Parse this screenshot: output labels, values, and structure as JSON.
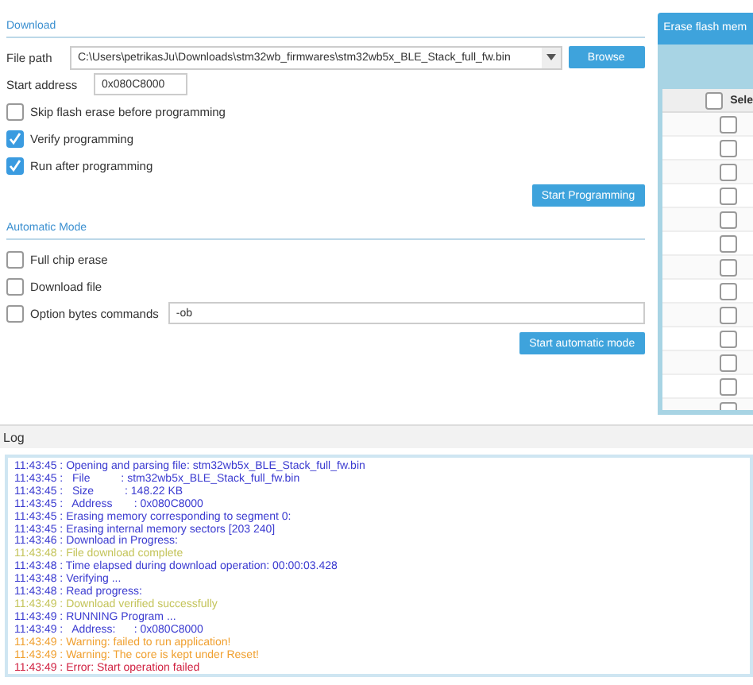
{
  "download": {
    "title": "Download",
    "file_path": {
      "label": "File path",
      "value": "C:\\Users\\petrikasJu\\Downloads\\stm32wb_firmwares\\stm32wb5x_BLE_Stack_full_fw.bin"
    },
    "browse_button": "Browse",
    "start_address": {
      "label": "Start address",
      "value": "0x080C8000"
    },
    "options": [
      {
        "label": "Skip flash erase before programming",
        "checked": false
      },
      {
        "label": "Verify programming",
        "checked": true
      },
      {
        "label": "Run after programming",
        "checked": true
      }
    ],
    "start_button": "Start Programming"
  },
  "automatic_mode": {
    "title": "Automatic Mode",
    "options": [
      {
        "label": "Full chip erase",
        "checked": false
      },
      {
        "label": "Download file",
        "checked": false
      },
      {
        "label": "Option bytes commands",
        "checked": false,
        "value": "-ob"
      }
    ],
    "start_button": "Start automatic mode"
  },
  "erase_panel": {
    "tab": "Erase flash mem",
    "table": {
      "select_all_checked": false,
      "header": "Sele",
      "rows": [
        {
          "checked": false
        },
        {
          "checked": false
        },
        {
          "checked": false
        },
        {
          "checked": false
        },
        {
          "checked": false
        },
        {
          "checked": false
        },
        {
          "checked": false
        },
        {
          "checked": false
        },
        {
          "checked": false
        },
        {
          "checked": false
        },
        {
          "checked": false
        },
        {
          "checked": false
        },
        {
          "checked": false
        }
      ]
    }
  },
  "log": {
    "title": "Log",
    "lines": [
      {
        "kind": "info",
        "text": "11:43:45 : Opening and parsing file: stm32wb5x_BLE_Stack_full_fw.bin"
      },
      {
        "kind": "info",
        "text": "11:43:45 :   File          : stm32wb5x_BLE_Stack_full_fw.bin"
      },
      {
        "kind": "info",
        "text": "11:43:45 :   Size          : 148.22 KB"
      },
      {
        "kind": "info",
        "text": "11:43:45 :   Address       : 0x080C8000"
      },
      {
        "kind": "info",
        "text": "11:43:45 : Erasing memory corresponding to segment 0:"
      },
      {
        "kind": "info",
        "text": "11:43:45 : Erasing internal memory sectors [203 240]"
      },
      {
        "kind": "info",
        "text": "11:43:46 : Download in Progress:"
      },
      {
        "kind": "success",
        "text": "11:43:48 : File download complete"
      },
      {
        "kind": "info",
        "text": "11:43:48 : Time elapsed during download operation: 00:00:03.428"
      },
      {
        "kind": "info",
        "text": "11:43:48 : Verifying ..."
      },
      {
        "kind": "info",
        "text": "11:43:48 : Read progress:"
      },
      {
        "kind": "success",
        "text": "11:43:49 : Download verified successfully"
      },
      {
        "kind": "info",
        "text": "11:43:49 : RUNNING Program ..."
      },
      {
        "kind": "info",
        "text": "11:43:49 :   Address:      : 0x080C8000"
      },
      {
        "kind": "warning",
        "text": "11:43:49 : Warning: failed to run application!"
      },
      {
        "kind": "warning",
        "text": "11:43:49 : Warning: The core is kept under Reset!"
      },
      {
        "kind": "error",
        "text": "11:43:49 : Error: Start operation failed"
      }
    ]
  }
}
